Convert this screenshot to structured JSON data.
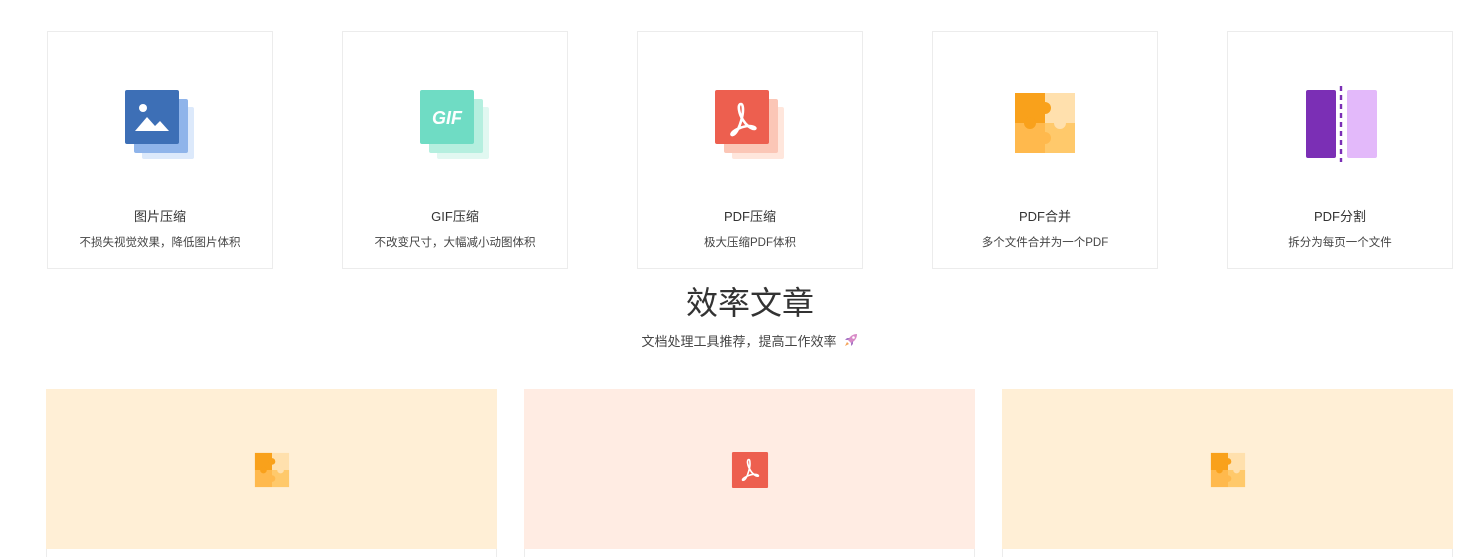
{
  "tools": [
    {
      "title": "图片压缩",
      "desc": "不损失视觉效果，降低图片体积",
      "icon": "image-compress-icon"
    },
    {
      "title": "GIF压缩",
      "desc": "不改变尺寸，大幅减小动图体积",
      "icon": "gif-compress-icon",
      "icon_text": "GIF"
    },
    {
      "title": "PDF压缩",
      "desc": "极大压缩PDF体积",
      "icon": "pdf-compress-icon"
    },
    {
      "title": "PDF合并",
      "desc": "多个文件合并为一个PDF",
      "icon": "pdf-merge-icon"
    },
    {
      "title": "PDF分割",
      "desc": "拆分为每页一个文件",
      "icon": "pdf-split-icon"
    }
  ],
  "articles_section": {
    "title": "效率文章",
    "subtitle": "文档处理工具推荐，提高工作效率"
  },
  "articles": [
    {
      "icon": "puzzle-icon",
      "bg": "#ffefd6"
    },
    {
      "icon": "pdf-icon",
      "bg": "#ffece3"
    },
    {
      "icon": "puzzle-icon",
      "bg": "#ffefd6"
    }
  ],
  "colors": {
    "image_blue": "#3d6fb6",
    "gif_teal": "#6fdcc4",
    "pdf_red": "#ed5f4f",
    "merge_orange": "#f9a11b",
    "split_purple": "#7b2fb5"
  }
}
